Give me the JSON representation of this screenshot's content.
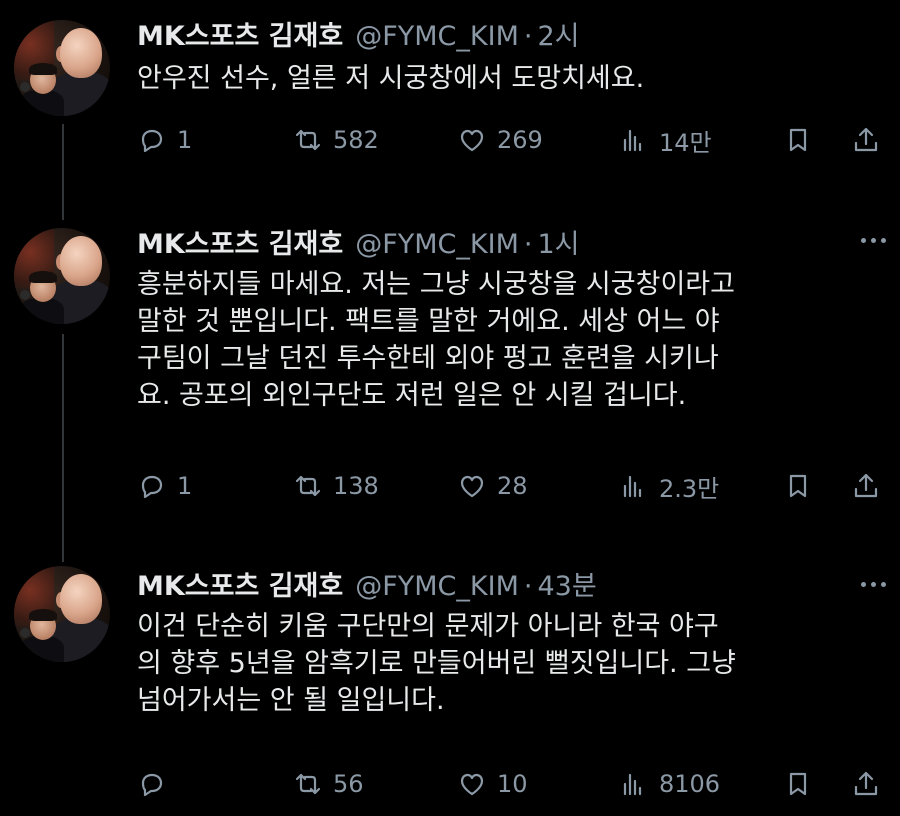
{
  "colors": {
    "background": "#000000",
    "primary_text": "#e7e9ea",
    "secondary_text": "#8b98a5",
    "thread_line": "#333639"
  },
  "icons": {
    "reply": "reply-icon",
    "retweet": "retweet-icon",
    "like": "heart-icon",
    "views": "views-icon",
    "bookmark": "bookmark-icon",
    "share": "share-icon",
    "more": "more-icon"
  },
  "tweets": [
    {
      "display_name": "MK스포츠 김재호",
      "handle": "@FYMC_KIM",
      "separator": "·",
      "time": "2시",
      "text_lines": [
        "안우진 선수, 얼른 저 시궁창에서 도망치세요."
      ],
      "replies": "1",
      "retweets": "582",
      "likes": "269",
      "views": "14만"
    },
    {
      "display_name": "MK스포츠 김재호",
      "handle": "@FYMC_KIM",
      "separator": "·",
      "time": "1시",
      "text_lines": [
        "흥분하지들 마세요. 저는 그냥 시궁창을 시궁창이라고",
        "말한 것 뿐입니다. 팩트를 말한 거에요. 세상 어느 야",
        "구팀이 그날 던진 투수한테 외야 펑고 훈련을 시키나",
        "요. 공포의 외인구단도 저런 일은 안 시킬 겁니다."
      ],
      "replies": "1",
      "retweets": "138",
      "likes": "28",
      "views": "2.3만"
    },
    {
      "display_name": "MK스포츠 김재호",
      "handle": "@FYMC_KIM",
      "separator": "·",
      "time": "43분",
      "text_lines": [
        "이건 단순히 키움 구단만의 문제가 아니라 한국 야구",
        "의 향후 5년을 암흑기로 만들어버린 뻘짓입니다. 그냥",
        "넘어가서는 안 될 일입니다."
      ],
      "replies": "",
      "retweets": "56",
      "likes": "10",
      "views": "8106"
    }
  ]
}
